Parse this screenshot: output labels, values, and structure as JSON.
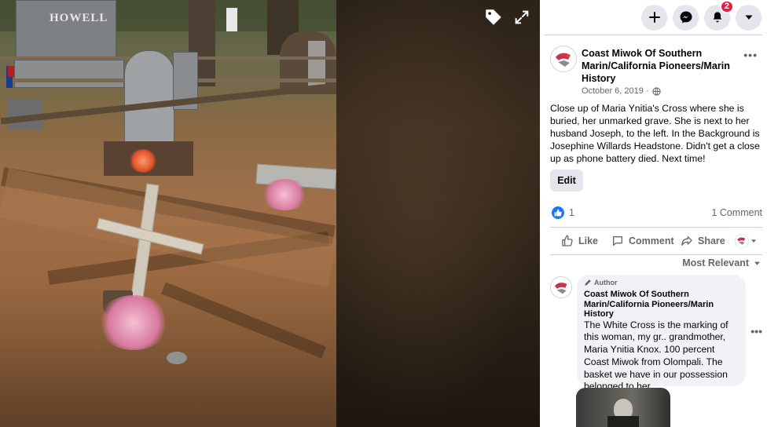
{
  "viewer": {
    "headstone_text": "HOWELL",
    "tag_icon": "tag-icon",
    "fullscreen_icon": "expand-icon"
  },
  "topbar": {
    "create_icon": "plus-icon",
    "messenger_icon": "messenger-icon",
    "notifications_icon": "bell-icon",
    "notifications_badge": "2",
    "account_icon": "caret-down-icon"
  },
  "post": {
    "page_name": "Coast Miwok Of Southern Marin/California Pioneers/Marin History",
    "date": "October 6, 2019 · ",
    "privacy_icon": "globe-icon",
    "text": "Close up of Maria Ynitia's Cross where she is buried, her unmarked grave. She is next to her husband Joseph, to the left. In the Background is Josephine Willards Headstone. Didn't get a close up as phone battery died. Next time!",
    "edit_label": "Edit",
    "reaction_count": "1",
    "comment_count": "1 Comment"
  },
  "actions": {
    "like": "Like",
    "comment": "Comment",
    "share": "Share"
  },
  "sort_label": "Most Relevant",
  "comment": {
    "author_badge": "Author",
    "name": "Coast Miwok Of Southern Marin/California Pioneers/Marin History",
    "text": "The White Cross is the marking of this woman, my gr.. grandmother, Maria Ynitia Knox. 100 percent Coast Miwok from Olompali. The basket we have in our possession belonged to her."
  },
  "colors": {
    "accent": "#1877f2",
    "badge": "#e41e3f",
    "secondary_text": "#65676b"
  }
}
